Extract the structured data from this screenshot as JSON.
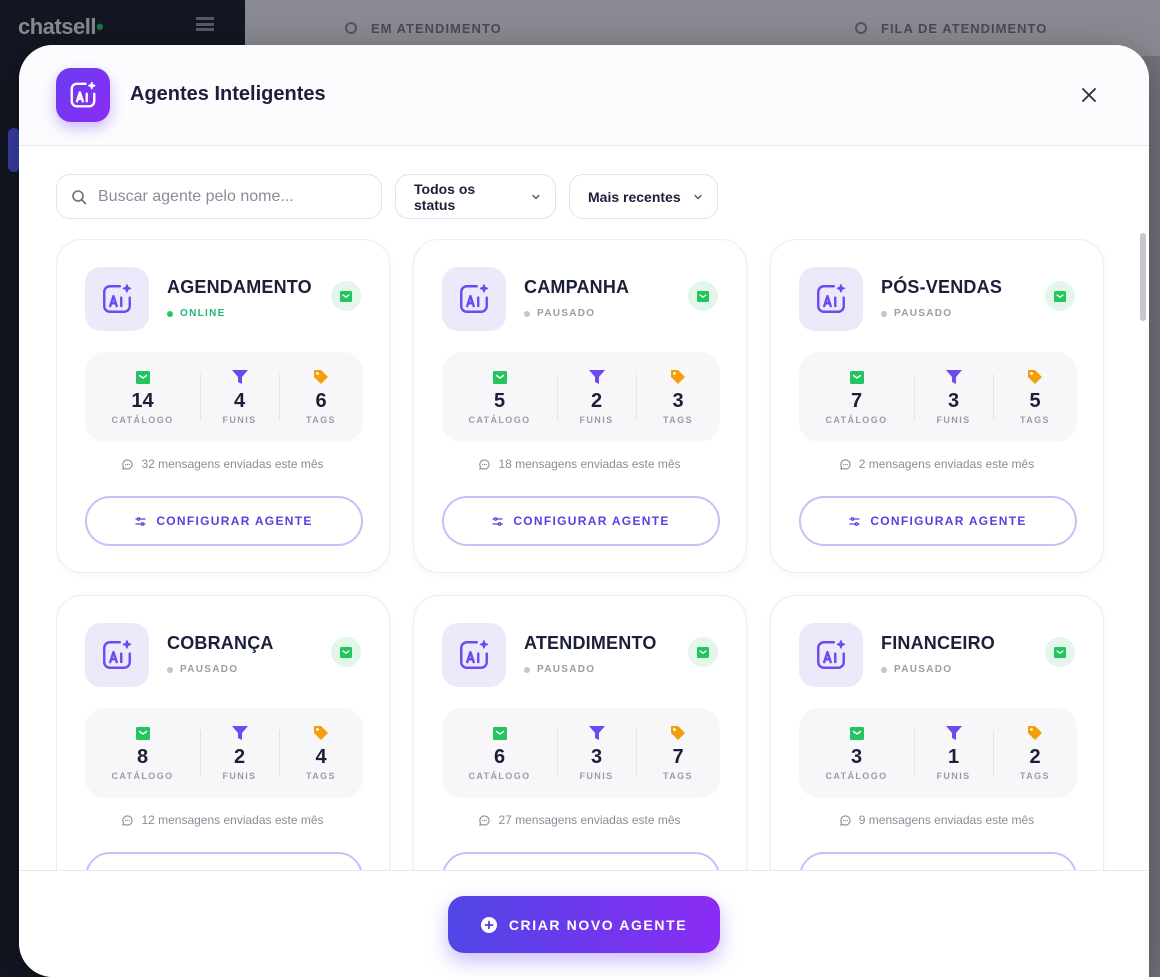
{
  "background": {
    "logo": "chatsell",
    "logo_dot": "•",
    "top_segments": [
      "EM ATENDIMENTO",
      "FILA DE ATENDIMENTO"
    ]
  },
  "modal": {
    "title": "Agentes Inteligentes",
    "search_placeholder": "Buscar agente pelo nome...",
    "status_filter": "Todos os status",
    "sort_filter": "Mais recentes",
    "stat_labels": {
      "catalog": "CATÁLOGO",
      "funnels": "FUNIS",
      "tags": "TAGS"
    },
    "configure_label": "CONFIGURAR AGENTE",
    "create_label": "CRIAR NOVO AGENTE"
  },
  "agents": [
    {
      "name": "AGENDAMENTO",
      "status": "ONLINE",
      "catalog": "14",
      "funnels": "4",
      "tags": "6",
      "messages": "32 mensagens enviadas este mês"
    },
    {
      "name": "CAMPANHA",
      "status": "PAUSADO",
      "catalog": "5",
      "funnels": "2",
      "tags": "3",
      "messages": "18 mensagens enviadas este mês"
    },
    {
      "name": "PÓS-VENDAS",
      "status": "PAUSADO",
      "catalog": "7",
      "funnels": "3",
      "tags": "5",
      "messages": "2 mensagens enviadas este mês"
    },
    {
      "name": "COBRANÇA",
      "status": "PAUSADO",
      "catalog": "8",
      "funnels": "2",
      "tags": "4",
      "messages": "12 mensagens enviadas este mês"
    },
    {
      "name": "ATENDIMENTO",
      "status": "PAUSADO",
      "catalog": "6",
      "funnels": "3",
      "tags": "7",
      "messages": "27 mensagens enviadas este mês"
    },
    {
      "name": "FINANCEIRO",
      "status": "PAUSADO",
      "catalog": "3",
      "funnels": "1",
      "tags": "2",
      "messages": "9 mensagens enviadas este mês"
    }
  ],
  "colors": {
    "accent": "#5b3ee0",
    "online": "#22c55e",
    "catalog_icon": "#22c55e",
    "funnel_icon": "#6d4af0",
    "tag_icon": "#f59e0b"
  },
  "icons": {
    "header": "ai-sparkle-icon",
    "close": "close-icon",
    "search": "search-icon",
    "chevron": "chevron-down-icon",
    "catalog": "catalog-icon",
    "funnel": "funnel-icon",
    "tag": "tag-icon",
    "message": "chat-bubble-icon",
    "sliders": "sliders-icon",
    "plus": "plus-circle-icon"
  }
}
